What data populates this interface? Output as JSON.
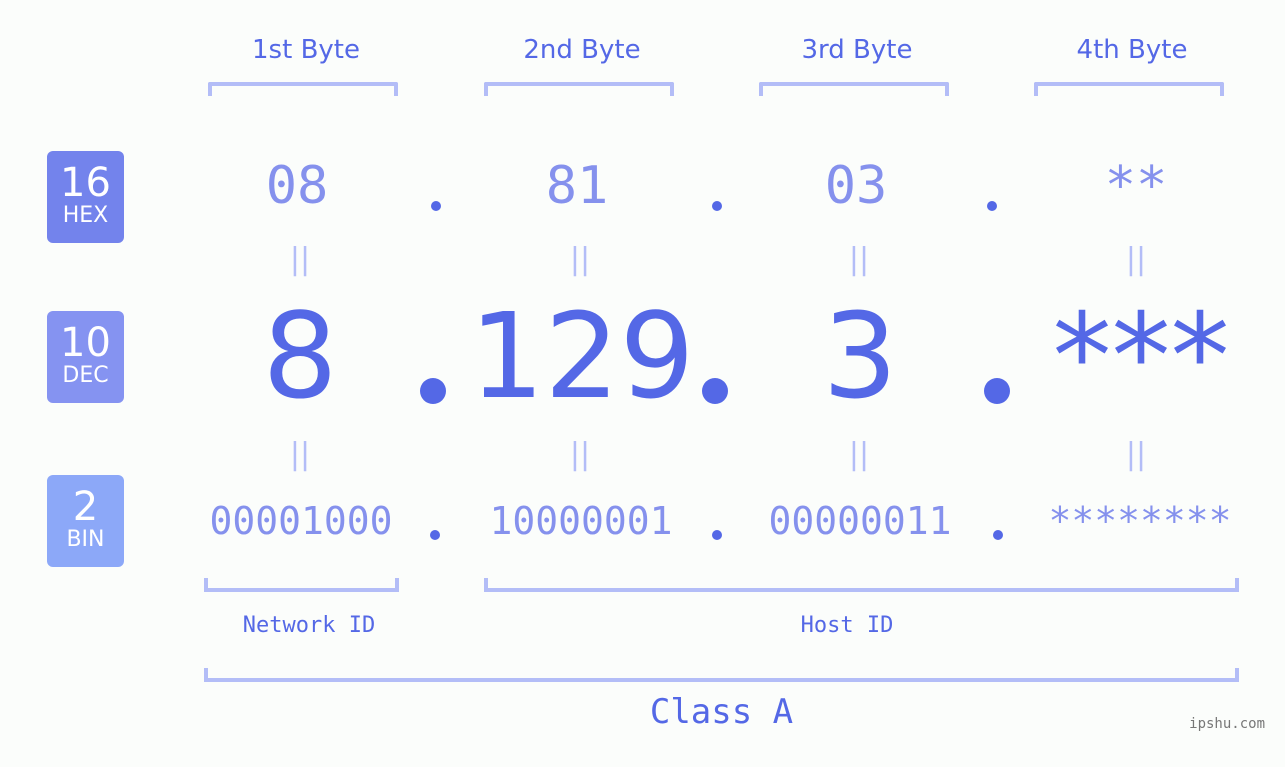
{
  "bytes": {
    "headers": [
      "1st Byte",
      "2nd Byte",
      "3rd Byte",
      "4th Byte"
    ]
  },
  "bases": [
    {
      "number": "16",
      "name": "HEX",
      "color": "#7383ec"
    },
    {
      "number": "10",
      "name": "DEC",
      "color": "#8593f1"
    },
    {
      "number": "2",
      "name": "BIN",
      "color": "#8ca8f8"
    }
  ],
  "hex": [
    "08",
    "81",
    "03",
    "**"
  ],
  "dec": [
    "8",
    "129",
    "3",
    "***"
  ],
  "bin": [
    "00001000",
    "10000001",
    "00000011",
    "********"
  ],
  "equals_symbol": "||",
  "labels": {
    "network_id": "Network ID",
    "host_id": "Host ID",
    "class": "Class A"
  },
  "watermark": "ipshu.com",
  "colors": {
    "primary": "#5468e6",
    "secondary": "#8591ed",
    "bracket": "#b3bdf7",
    "background": "#fbfdfb"
  }
}
